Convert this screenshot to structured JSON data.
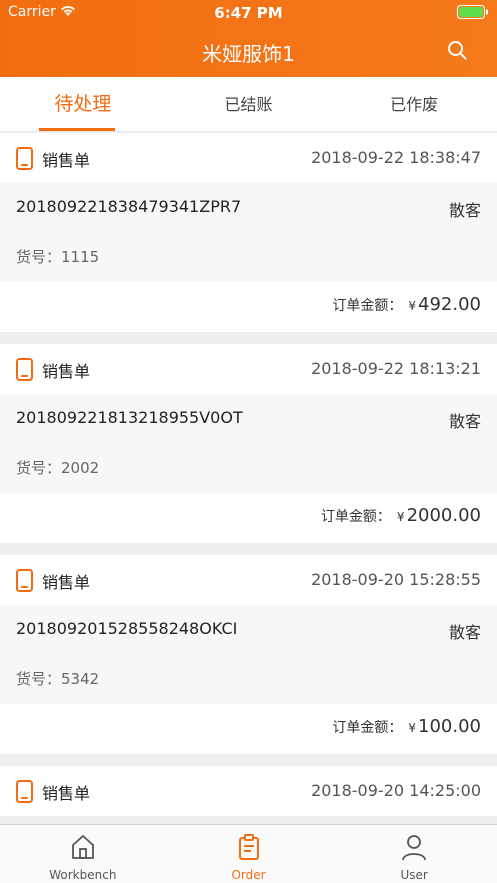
{
  "status_bar": {
    "carrier": "Carrier",
    "time": "6:47 PM"
  },
  "nav": {
    "title": "米娅服饰1",
    "search_icon": "search-icon"
  },
  "tabs": [
    {
      "label": "待处理",
      "active": true
    },
    {
      "label": "已结账",
      "active": false
    },
    {
      "label": "已作废",
      "active": false
    }
  ],
  "orders": [
    {
      "type": "销售单",
      "time": "2018-09-22 18:38:47",
      "order_no": "20180922183847934​1ZPR7",
      "customer": "散客",
      "item_no": "货号：1115",
      "amount_label": "订单金额：",
      "currency": "¥",
      "amount": "492.00"
    },
    {
      "type": "销售单",
      "time": "2018-09-22 18:13:21",
      "order_no": "20180922181321895​5V0OT",
      "customer": "散客",
      "item_no": "货号：2002",
      "amount_label": "订单金额：",
      "currency": "¥",
      "amount": "2000.00"
    },
    {
      "type": "销售单",
      "time": "2018-09-20 15:28:55",
      "order_no": "20180920152855824​8OKCI",
      "customer": "散客",
      "item_no": "货号：5342",
      "amount_label": "订单金额：",
      "currency": "¥",
      "amount": "100.00"
    },
    {
      "type": "销售单",
      "time": "2018-09-20 14:25:00"
    }
  ],
  "tabbar": [
    {
      "label": "Workbench",
      "icon": "home-icon"
    },
    {
      "label": "Order",
      "icon": "clipboard-icon",
      "active": true
    },
    {
      "label": "User",
      "icon": "user-icon"
    }
  ],
  "colors": {
    "accent": "#f26d10"
  }
}
